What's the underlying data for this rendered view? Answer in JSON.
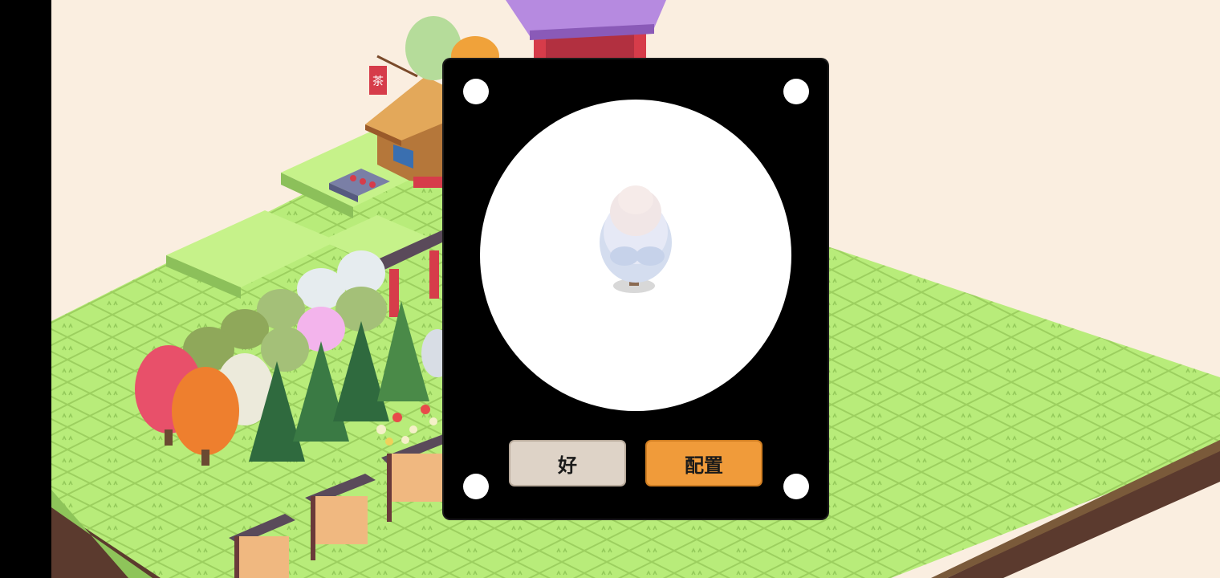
{
  "dialog": {
    "preview_item": "frosted-white-tree",
    "ok_label": "好",
    "place_label": "配置"
  },
  "scene": {
    "shop_sign_label": "茶",
    "background_color": "#faeee0",
    "grass_color": "#b9ee7c",
    "button_ok_color": "#ded3c7",
    "button_place_color": "#f09b3a"
  }
}
